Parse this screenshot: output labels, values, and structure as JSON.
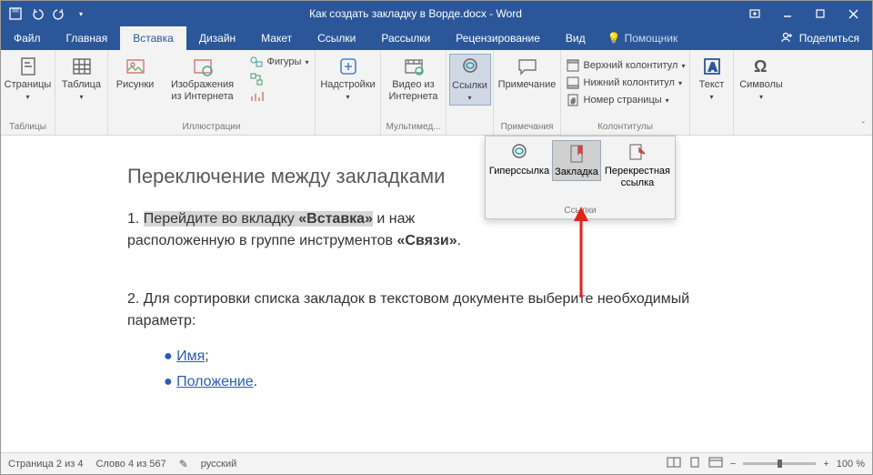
{
  "title": "Как создать закладку в Ворде.docx  -  Word",
  "tabs": {
    "file": "Файл",
    "home": "Главная",
    "insert": "Вставка",
    "design": "Дизайн",
    "layout": "Макет",
    "references": "Ссылки",
    "mailings": "Рассылки",
    "review": "Рецензирование",
    "view": "Вид"
  },
  "tellme": "Помощник",
  "share": "Поделиться",
  "ribbon": {
    "pages": "Страницы",
    "tables": {
      "label": "Таблицы",
      "btn": "Таблица"
    },
    "illustrations": {
      "label": "Иллюстрации",
      "pictures": "Рисунки",
      "online_pictures": "Изображения из Интернета",
      "shapes": "Фигуры"
    },
    "addins": {
      "label": "",
      "btn": "Надстройки"
    },
    "media": {
      "label": "Мультимед...",
      "video": "Видео из Интернета"
    },
    "links": {
      "label": "",
      "btn": "Ссылки"
    },
    "comments": {
      "label": "Примечания",
      "btn": "Примечание"
    },
    "header_footer": {
      "label": "Колонтитулы",
      "header": "Верхний колонтитул",
      "footer": "Нижний колонтитул",
      "page_number": "Номер страницы"
    },
    "text": {
      "label": "",
      "btn": "Текст"
    },
    "symbols": {
      "label": "",
      "btn": "Символы"
    }
  },
  "dropdown": {
    "hyperlink": "Гиперссылка",
    "bookmark": "Закладка",
    "crossref": "Перекрестная ссылка",
    "group": "Ссылки"
  },
  "doc": {
    "heading": "Переключение между закладками",
    "p1_a": "1. ",
    "p1_sel": "Перейдите во вкладку ",
    "p1_bold": "«Вставка»",
    "p1_b": " и наж",
    "p1_c": "расположенную в группе инструментов ",
    "p1_bold2": "«Связи»",
    "p1_d": ".",
    "p2": "2. Для сортировки списка закладок в текстовом документе выберите необходимый параметр:",
    "b1": "Имя",
    "b1_tail": ";",
    "b2": "Положение",
    "b2_tail": "."
  },
  "status": {
    "page": "Страница 2 из 4",
    "words": "Слово 4 из 567",
    "lang": "русский",
    "zoom": "100 %"
  }
}
